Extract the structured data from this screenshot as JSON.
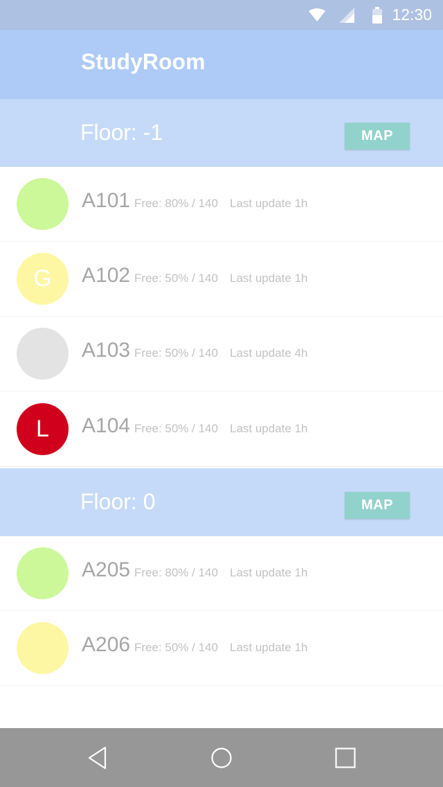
{
  "status_bar": {
    "time": "12:30",
    "icons": [
      "wifi-icon",
      "cellular-signal-icon",
      "battery-icon"
    ]
  },
  "app_bar": {
    "title": "StudyRoom"
  },
  "floors": [
    {
      "label": "Floor: -1",
      "map_label": "MAP",
      "rooms": [
        {
          "name": "A101",
          "free": "Free: 80% / 140",
          "update": "Last update 1h",
          "avatar_letter": "",
          "avatar_color": "#ccf89a"
        },
        {
          "name": "A102",
          "free": "Free: 50% / 140",
          "update": "Last update 1h",
          "avatar_letter": "G",
          "avatar_color": "#fdf7a4"
        },
        {
          "name": "A103",
          "free": "Free: 50% / 140",
          "update": "Last update 4h",
          "avatar_letter": "",
          "avatar_color": "#e3e3e3"
        },
        {
          "name": "A104",
          "free": "Free: 50% / 140",
          "update": "Last update 1h",
          "avatar_letter": "L",
          "avatar_color": "#d0001c"
        }
      ]
    },
    {
      "label": "Floor: 0",
      "map_label": "MAP",
      "rooms": [
        {
          "name": "A205",
          "free": "Free: 80% / 140",
          "update": "Last update 1h",
          "avatar_letter": "",
          "avatar_color": "#ccf89a"
        },
        {
          "name": "A206",
          "free": "Free: 50% / 140",
          "update": "Last update 1h",
          "avatar_letter": "",
          "avatar_color": "#fdf7a4"
        }
      ]
    }
  ],
  "nav_bar": {
    "icons": [
      "back-icon",
      "home-icon",
      "recents-icon"
    ]
  },
  "colors": {
    "status_bar": "#adc1e2",
    "app_bar": "#aecbf7",
    "floor_header": "#c5daf9",
    "map_button": "#92d2cc",
    "nav_bar": "#979797"
  }
}
